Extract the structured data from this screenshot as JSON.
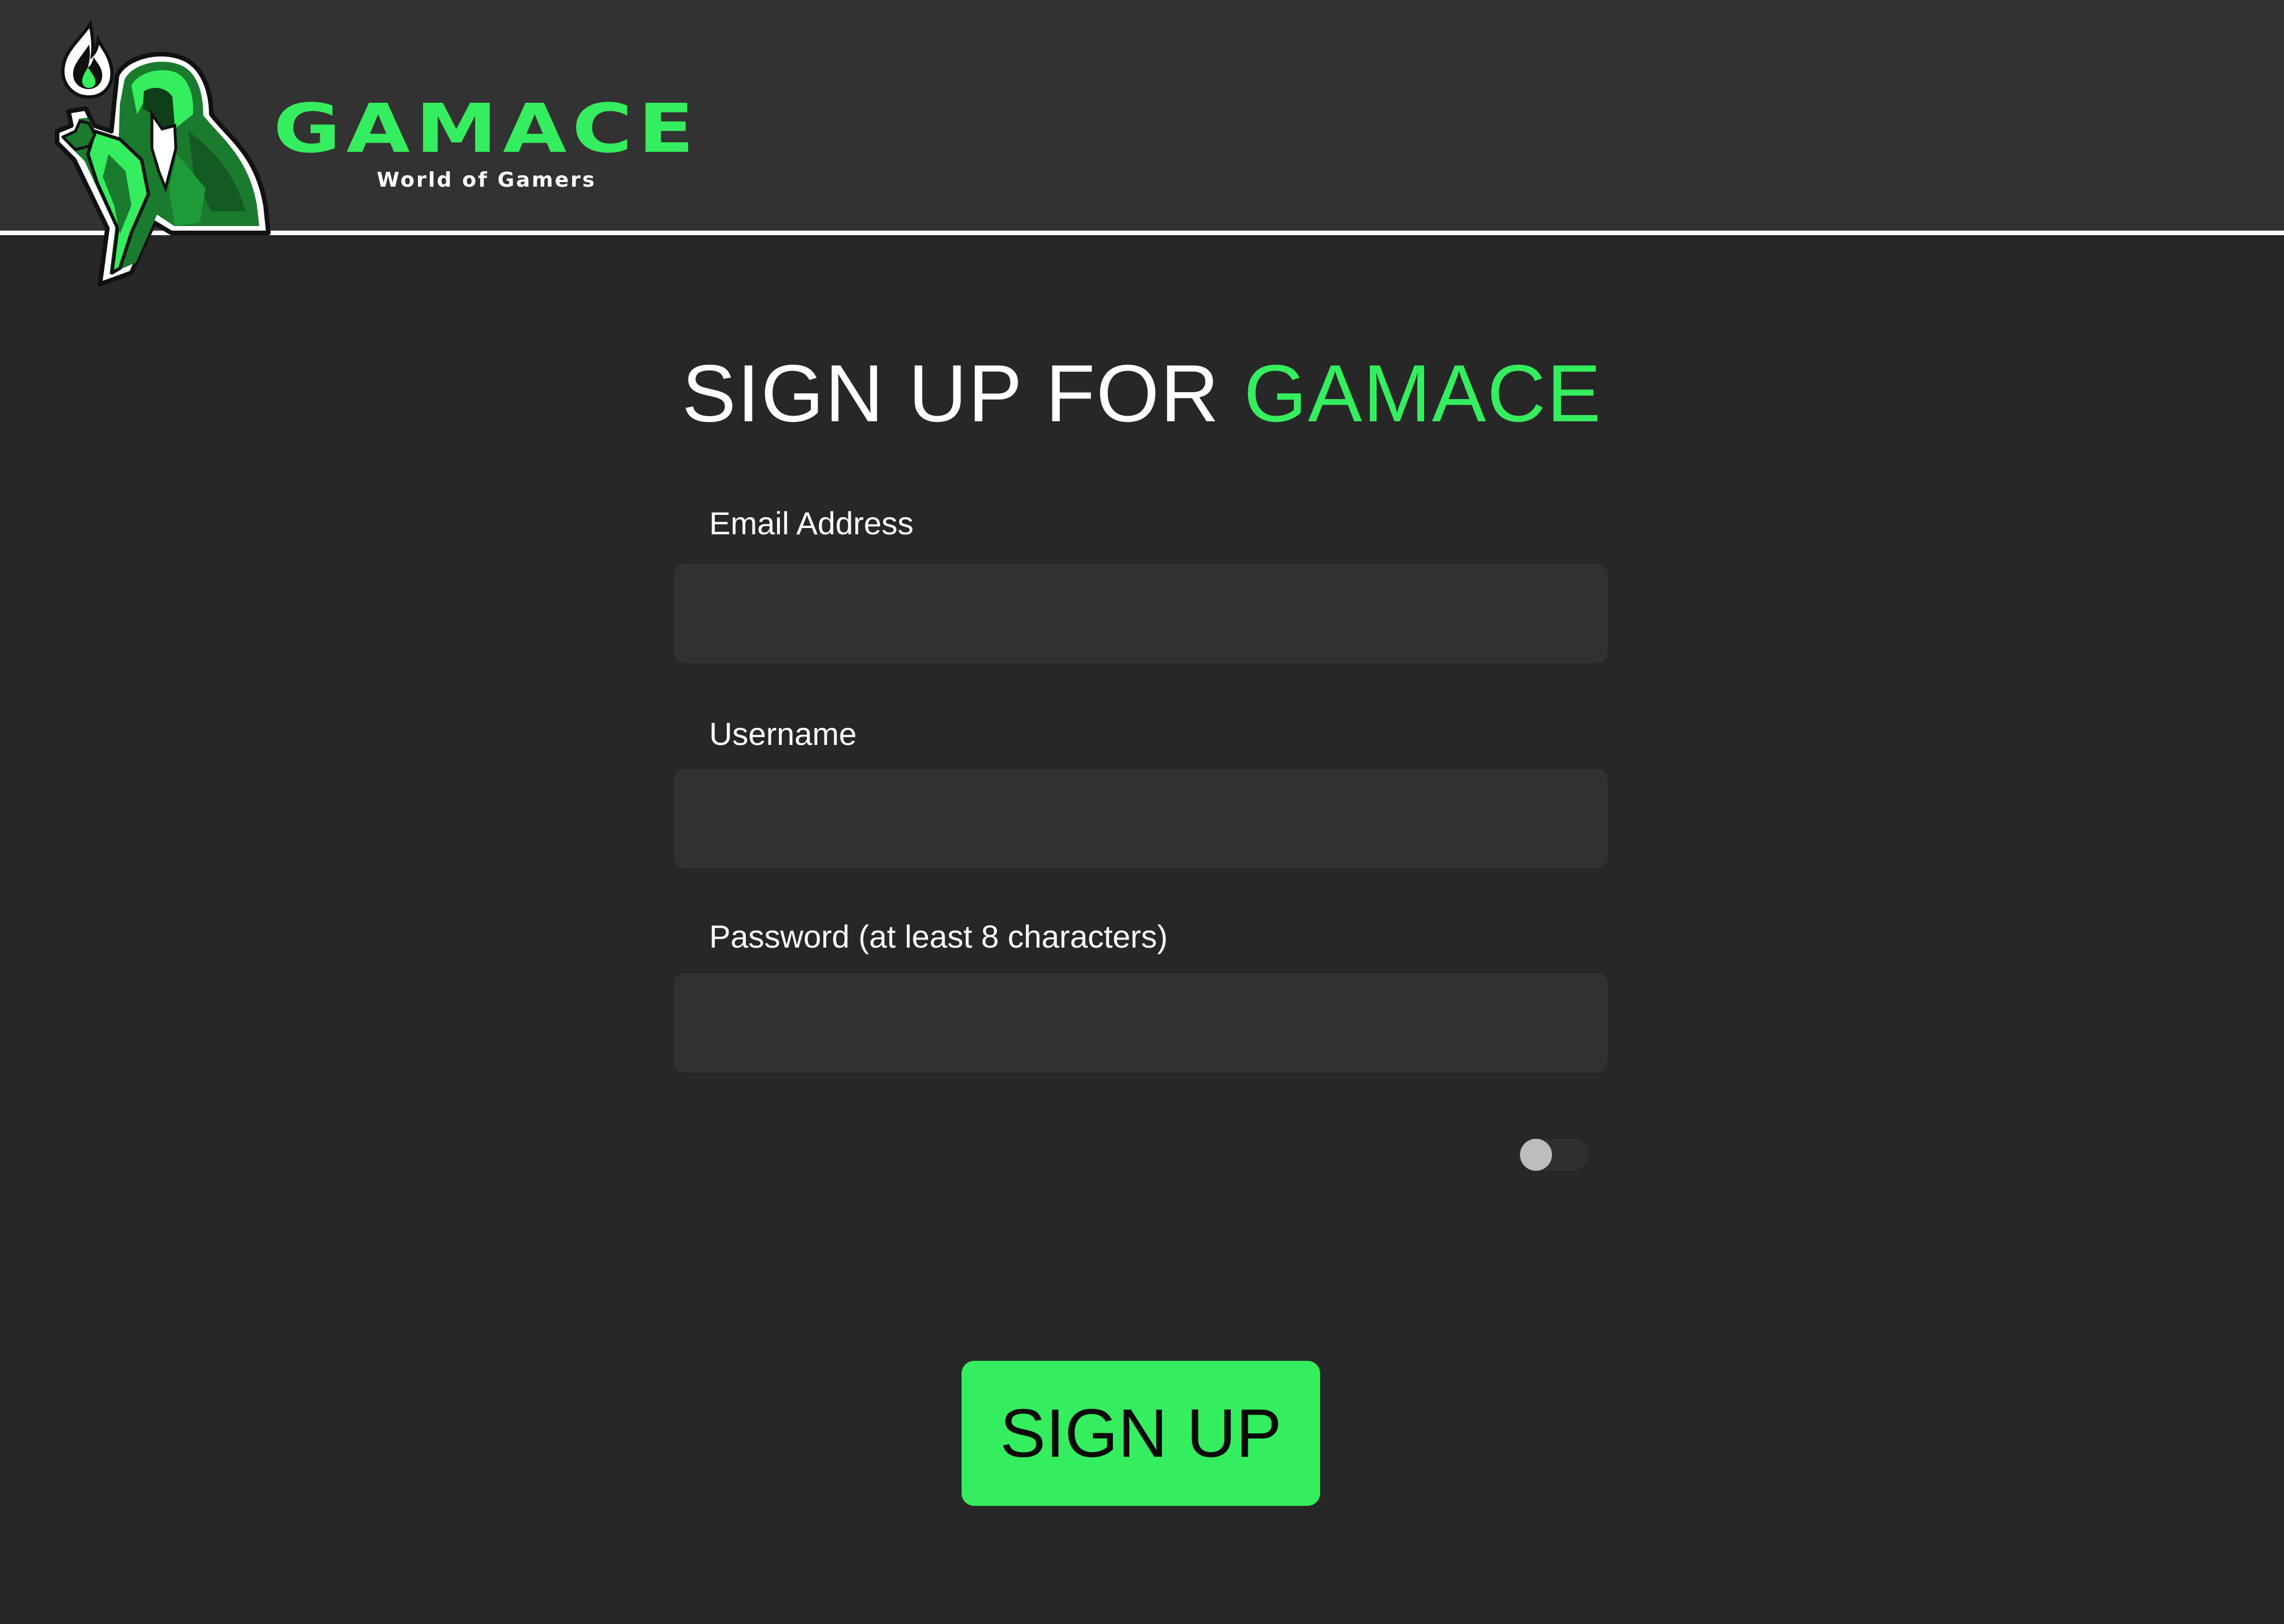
{
  "brand": {
    "name": "GAMACE",
    "tagline": "World of Gamers"
  },
  "form": {
    "title_prefix": "SIGN UP FOR",
    "title_accent": "GAMACE",
    "email_label": "Email Address",
    "email_value": "",
    "username_label": "Username",
    "username_value": "",
    "password_label": "Password (at least 8 characters)",
    "password_value": "",
    "show_password_toggle": {
      "state": "off"
    },
    "submit_label": "SIGN UP"
  },
  "colors": {
    "accent": "#35ee5f",
    "background": "#272727",
    "header_background": "#323232",
    "input_background": "#313131",
    "text": "#ffffff"
  },
  "icons": [
    "gamace-mascot-logo",
    "toggle-switch"
  ]
}
